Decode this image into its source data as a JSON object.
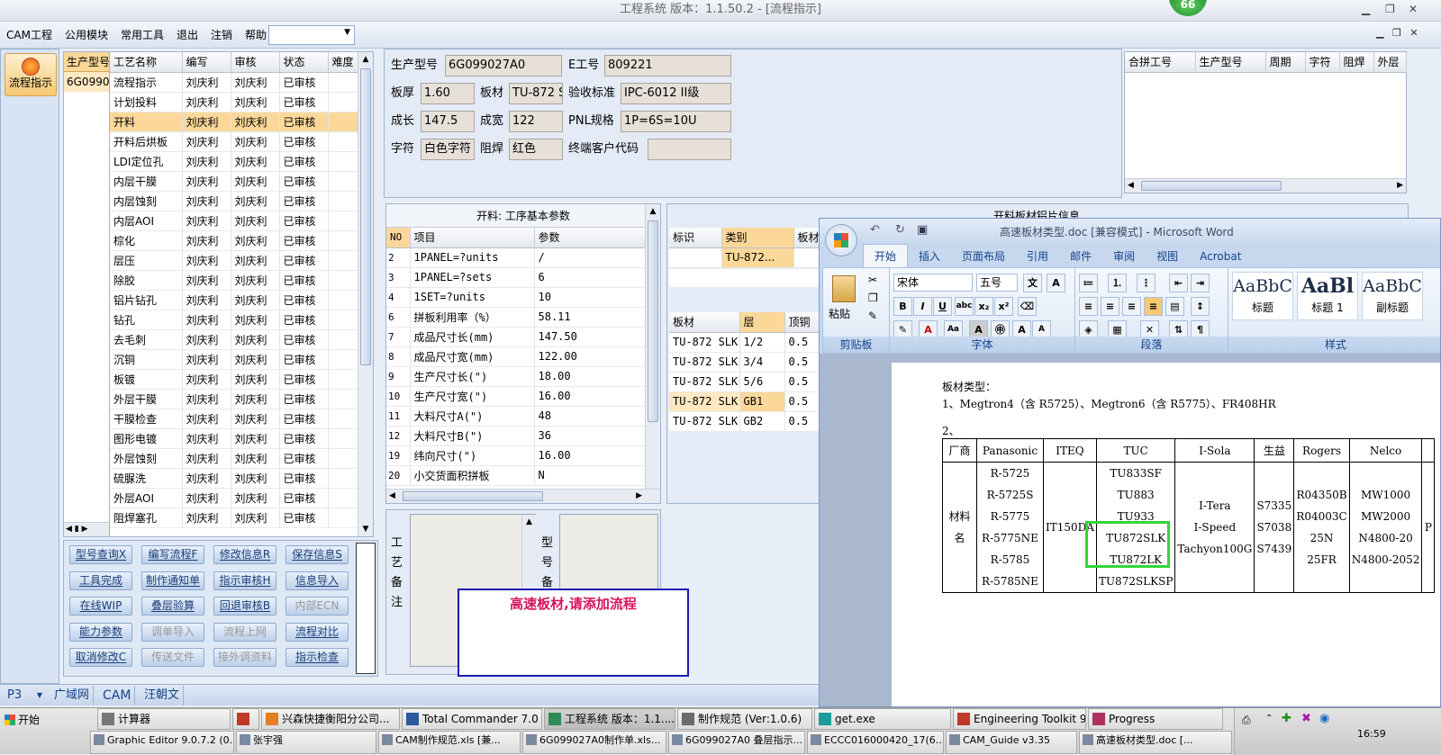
{
  "title": "工程系统  版本：1.1.50.2 - [流程指示]",
  "badge": "66",
  "menu": [
    "CAM工程",
    "公用模块",
    "常用工具",
    "退出",
    "注销",
    "帮助"
  ],
  "side_button": "流程指示",
  "left_list": {
    "header": "生产型号",
    "value": "6G0990"
  },
  "process_grid": {
    "headers": [
      "工艺名称",
      "编写",
      "审核",
      "状态",
      "难度"
    ],
    "selected_index": 2,
    "rows": [
      [
        "流程指示",
        "刘庆利",
        "刘庆利",
        "已审核",
        ""
      ],
      [
        "计划投料",
        "刘庆利",
        "刘庆利",
        "已审核",
        ""
      ],
      [
        "开料",
        "刘庆利",
        "刘庆利",
        "已审核",
        ""
      ],
      [
        "开料后烘板",
        "刘庆利",
        "刘庆利",
        "已审核",
        ""
      ],
      [
        "LDI定位孔",
        "刘庆利",
        "刘庆利",
        "已审核",
        ""
      ],
      [
        "内层干膜",
        "刘庆利",
        "刘庆利",
        "已审核",
        ""
      ],
      [
        "内层蚀刻",
        "刘庆利",
        "刘庆利",
        "已审核",
        ""
      ],
      [
        "内层AOI",
        "刘庆利",
        "刘庆利",
        "已审核",
        ""
      ],
      [
        "棕化",
        "刘庆利",
        "刘庆利",
        "已审核",
        ""
      ],
      [
        "层压",
        "刘庆利",
        "刘庆利",
        "已审核",
        ""
      ],
      [
        "除胶",
        "刘庆利",
        "刘庆利",
        "已审核",
        ""
      ],
      [
        "铝片钻孔",
        "刘庆利",
        "刘庆利",
        "已审核",
        ""
      ],
      [
        "钻孔",
        "刘庆利",
        "刘庆利",
        "已审核",
        ""
      ],
      [
        "去毛刺",
        "刘庆利",
        "刘庆利",
        "已审核",
        ""
      ],
      [
        "沉铜",
        "刘庆利",
        "刘庆利",
        "已审核",
        ""
      ],
      [
        "板镀",
        "刘庆利",
        "刘庆利",
        "已审核",
        ""
      ],
      [
        "外层干膜",
        "刘庆利",
        "刘庆利",
        "已审核",
        ""
      ],
      [
        "干膜检查",
        "刘庆利",
        "刘庆利",
        "已审核",
        ""
      ],
      [
        "图形电镀",
        "刘庆利",
        "刘庆利",
        "已审核",
        ""
      ],
      [
        "外层蚀刻",
        "刘庆利",
        "刘庆利",
        "已审核",
        ""
      ],
      [
        "硫脲洗",
        "刘庆利",
        "刘庆利",
        "已审核",
        ""
      ],
      [
        "外层AOI",
        "刘庆利",
        "刘庆利",
        "已审核",
        ""
      ],
      [
        "阻焊塞孔",
        "刘庆利",
        "刘庆利",
        "已审核",
        ""
      ]
    ]
  },
  "buttons": [
    [
      "型号查询X",
      "编写流程F",
      "修改信息R",
      "保存信息S"
    ],
    [
      "工具完成",
      "制作通知单",
      "指示审核H",
      "信息导入"
    ],
    [
      "在线WIP",
      "叠层验算",
      "回退审核B",
      "内部ECN"
    ],
    [
      "能力参数",
      "调单导入",
      "流程上网",
      "流程对比"
    ],
    [
      "取消修改C",
      "传送文件",
      "接外调资料",
      "指示检查"
    ]
  ],
  "disabled_buttons": [
    "内部ECN",
    "调单导入",
    "流程上网",
    "传送文件",
    "接外调资料"
  ],
  "info": {
    "prod_model_label": "生产型号",
    "prod_model": "6G099027A0",
    "e_no_label": "E工号",
    "e_no": "809221",
    "thickness_label": "板厚",
    "thickness": "1.60",
    "material_label": "板材",
    "material": "TU-872 S",
    "standard_label": "验收标准",
    "standard": "IPC-6012 II级",
    "length_label": "成长",
    "length": "147.5",
    "width_label": "成宽",
    "width": "122",
    "pnl_label": "PNL规格",
    "pnl": "1P=6S=10U",
    "char_label": "字符",
    "char": "白色字符",
    "mask_label": "阻焊",
    "mask": "红色",
    "customer_label": "终端客户代码",
    "customer": ""
  },
  "merge_grid": {
    "headers": [
      "合拼工号",
      "生产型号",
      "周期",
      "字符",
      "阻焊",
      "外层"
    ]
  },
  "param_panel": {
    "title": "开料: 工序基本参数",
    "headers": [
      "NO",
      "项目",
      "参数"
    ],
    "rows": [
      [
        "2",
        "1PANEL=?units",
        "/"
      ],
      [
        "3",
        "1PANEL=?sets",
        "6"
      ],
      [
        "4",
        "1SET=?units",
        "10"
      ],
      [
        "6",
        "拼板利用率（%）",
        "58.11"
      ],
      [
        "7",
        "成品尺寸长(mm)",
        "147.50"
      ],
      [
        "8",
        "成品尺寸宽(mm)",
        "122.00"
      ],
      [
        "9",
        "生产尺寸长(\")",
        "18.00"
      ],
      [
        "10",
        "生产尺寸宽(\")",
        "16.00"
      ],
      [
        "11",
        "大料尺寸A(\")",
        "48"
      ],
      [
        "12",
        "大料尺寸B(\")",
        "36"
      ],
      [
        "19",
        "纬向尺寸(\")",
        "16.00"
      ],
      [
        "20",
        "小交货面积拼板",
        "N"
      ]
    ]
  },
  "cut_panel": {
    "title": "开料板材铝片信息",
    "top_headers": [
      "标识",
      "类别",
      "板材"
    ],
    "top_row": [
      "",
      "TU-872...",
      ""
    ],
    "headers": [
      "板材",
      "层",
      "顶铜"
    ],
    "rows": [
      [
        "TU-872 SLK",
        "1/2",
        "0.5"
      ],
      [
        "TU-872 SLK",
        "3/4",
        "0.5"
      ],
      [
        "TU-872 SLK",
        "5/6",
        "0.5"
      ],
      [
        "TU-872 SLK",
        "GB1",
        "0.5"
      ],
      [
        "TU-872 SLK",
        "GB2",
        "0.5"
      ]
    ]
  },
  "remarks": {
    "process_label": "工艺备注",
    "model_label": "型号备注"
  },
  "popup": {
    "text": "高速板材,请添加流程"
  },
  "bottom_tabs": {
    "select": "P3",
    "tabs": [
      "广域网",
      "CAM",
      "汪朝文"
    ]
  },
  "word": {
    "title": "高速板材类型.doc [兼容模式] - Microsoft Word",
    "tabs": [
      "开始",
      "插入",
      "页面布局",
      "引用",
      "邮件",
      "审阅",
      "视图",
      "Acrobat"
    ],
    "font": "宋体",
    "size": "五号",
    "paste": "粘贴",
    "groups": [
      "剪贴板",
      "字体",
      "段落",
      "样式"
    ],
    "styles": [
      {
        "preview": "AaBbC",
        "name": "标题"
      },
      {
        "preview": "AaBl",
        "name": "标题 1"
      },
      {
        "preview": "AaBbC",
        "name": "副标题"
      }
    ],
    "doc_line1": "板材类型：",
    "doc_line2": "1、Megtron4（含 R5725）、Megtron6（含 R5775）、FR408HR",
    "doc_line3": "2、",
    "table_headers": [
      "厂商",
      "Panasonic",
      "ITEQ",
      "TUC",
      "I-Sola",
      "生益",
      "Rogers",
      "Nelco"
    ],
    "row_label": "材料名",
    "panasonic": [
      "R-5725",
      "R-5725S",
      "R-5775",
      "R-5775NE",
      "R-5785",
      "R-5785NE"
    ],
    "iteq": [
      "IT150DA"
    ],
    "tuc": [
      "TU833SF",
      "TU883",
      "TU933",
      "TU872SLK",
      "TU872LK",
      "TU872SLKSP"
    ],
    "isola": [
      "I-Tera",
      "I-Speed",
      "Tachyon100G"
    ],
    "shengyi": [
      "S7335",
      "S7038",
      "S7439"
    ],
    "rogers": [
      "R04350B",
      "R04003C",
      "25N",
      "25FR"
    ],
    "nelco": [
      "MW1000",
      "MW2000",
      "N4800-20",
      "N4800-2052"
    ],
    "extra": "P"
  },
  "taskbar": {
    "start": "开始",
    "items": [
      "计算器",
      "",
      "兴森快捷衡阳分公司...",
      "Total Commander 7.0 p...",
      "工程系统  版本：1.1....",
      "制作规范 (Ver:1.0.6)",
      "get.exe",
      "Engineering Toolkit 9.0...",
      "Progress"
    ],
    "items2": [
      "Graphic Editor 9.0.7.2 (0...",
      "张宇强",
      "CAM制作规范.xls [兼...",
      "6G099027A0制作单.xls...",
      "6G099027A0 叠层指示...",
      "ECCC016000420_17(6...",
      "CAM_Guide v3.35",
      "高速板材类型.doc [..."
    ],
    "clock": "16:59"
  }
}
